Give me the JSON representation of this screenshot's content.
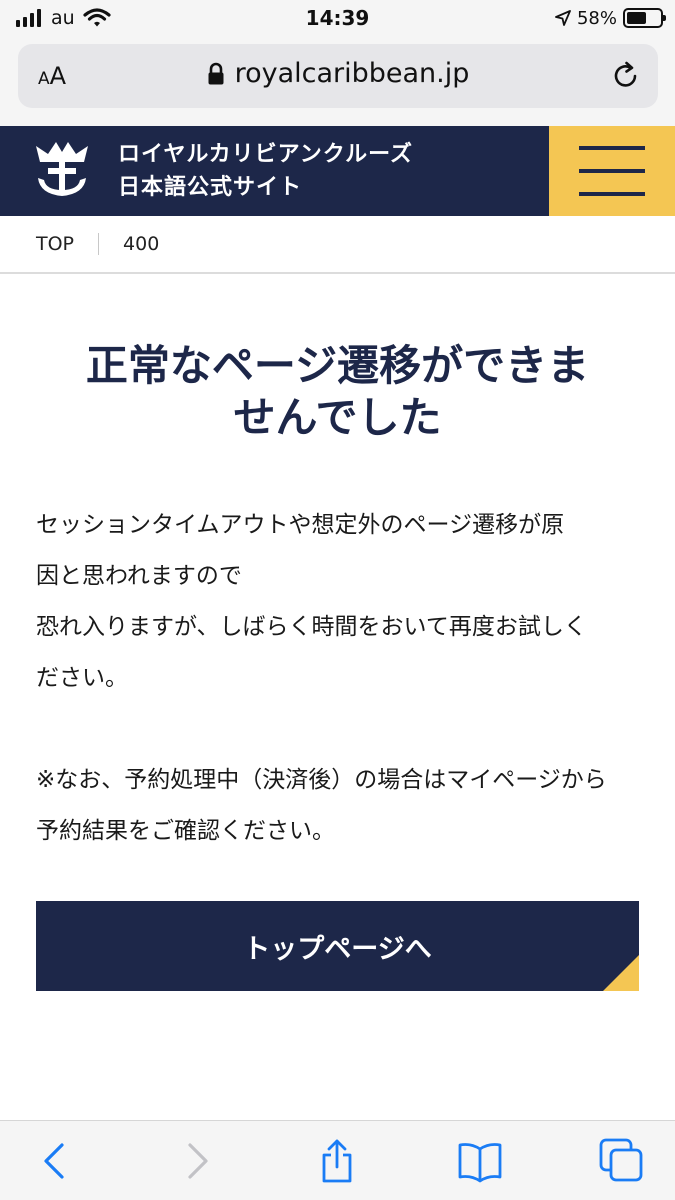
{
  "status_bar": {
    "carrier": "au",
    "time": "14:39",
    "battery": "58%",
    "battery_level": 0.58
  },
  "browser": {
    "text_size_label_small": "A",
    "text_size_label_large": "A",
    "url": "royalcaribbean.jp"
  },
  "header": {
    "brand_line1": "ロイヤルカリビアンクルーズ",
    "brand_line2": "日本語公式サイト",
    "menu_icon": "hamburger-icon",
    "logo_icon": "crown-anchor-logo"
  },
  "breadcrumb": {
    "items": [
      "TOP",
      "400"
    ]
  },
  "main": {
    "title_line1": "正常なページ遷移ができま",
    "title_line2": "せんでした",
    "paragraph1_line1": "セッションタイムアウトや想定外のページ遷移が原",
    "paragraph1_line2": "因と思われますので",
    "paragraph2_line1": "恐れ入りますが、しばらく時間をおいて再度お試しく",
    "paragraph2_line2": "ださい。",
    "paragraph3_line1": "※なお、予約処理中（決済後）の場合はマイページから",
    "paragraph3_line2": "予約結果をご確認ください。",
    "button_label": "トップページへ"
  },
  "toolbar": {
    "icons": [
      "back-icon",
      "forward-icon",
      "share-icon",
      "bookmarks-icon",
      "tabs-icon"
    ]
  },
  "colors": {
    "navy": "#1d2749",
    "yellow": "#f4c653",
    "ios_blue": "#1a7cf5"
  }
}
